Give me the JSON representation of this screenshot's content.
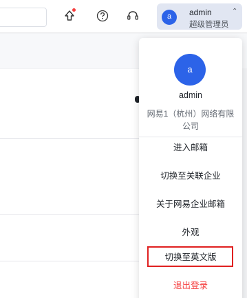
{
  "header": {
    "user": {
      "avatar_letter": "a",
      "name": "admin",
      "role": "超级管理员",
      "caret": "⌃"
    },
    "icons": [
      "upgrade-icon",
      "help-icon",
      "support-headset-icon"
    ],
    "notification_color": "#f53f3f"
  },
  "menu": {
    "avatar_letter": "a",
    "name": "admin",
    "company": "网易1（杭州）网络有限公司",
    "items": [
      {
        "label": "进入邮箱"
      },
      {
        "label": "切换至关联企业"
      },
      {
        "label": "关于网易企业邮箱"
      },
      {
        "label": "外观"
      },
      {
        "label": "切换至英文版",
        "highlighted": true
      },
      {
        "label": "退出登录",
        "color": "#f53f3f"
      }
    ]
  },
  "colors": {
    "accent": "#2c63e8",
    "danger": "#f53f3f",
    "highlight_border": "#e02020"
  }
}
